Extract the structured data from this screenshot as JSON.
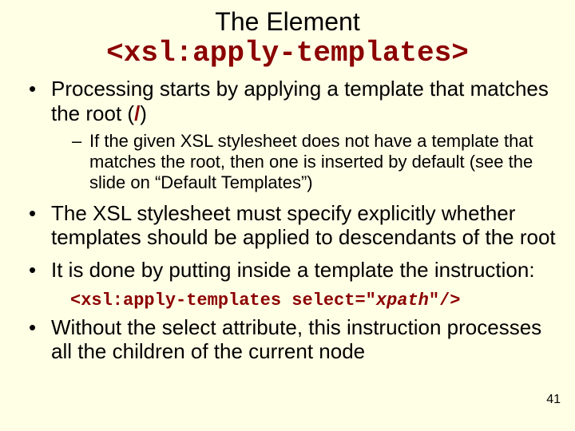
{
  "title": {
    "line1": "The Element",
    "line2": "<xsl:apply-templates>"
  },
  "bullets": {
    "b1_pre": "Processing starts by applying a template that matches the root (",
    "b1_slash": "/",
    "b1_post": ")",
    "b1_sub1": "If the given XSL stylesheet does not have a template that matches the root, then one is inserted by default (see the slide on “Default Templates”)",
    "b2": "The XSL stylesheet must specify explicitly whether templates should be applied to descendants of the root",
    "b3": "It is done by putting inside a template the instruction:",
    "code_pre": "<xsl:apply-templates select=\"",
    "code_mid": "xpath",
    "code_post": "\"/>",
    "b4": "Without the select attribute, this instruction processes all the children of the current node"
  },
  "page_number": "41"
}
